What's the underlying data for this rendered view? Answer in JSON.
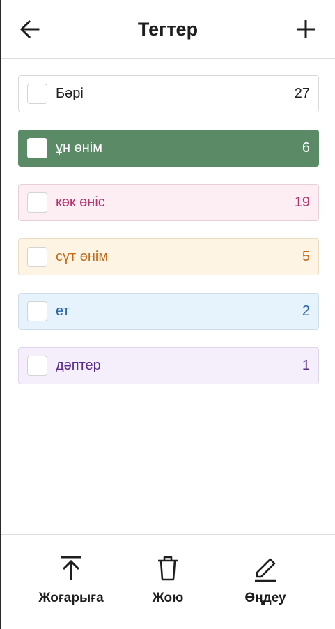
{
  "header": {
    "title": "Тегтер",
    "back_icon": "arrow-left-icon",
    "add_icon": "plus-icon"
  },
  "tags": [
    {
      "label": "Бәрі",
      "count": "27",
      "selected": false,
      "color": "#ffffff"
    },
    {
      "label": "ұн өнім",
      "count": "6",
      "selected": false,
      "color": "#5a8a66"
    },
    {
      "label": "көк өніс",
      "count": "19",
      "selected": false,
      "color": "#fdeef3"
    },
    {
      "label": "сүт өнім",
      "count": "5",
      "selected": false,
      "color": "#fdf4e3"
    },
    {
      "label": "ет",
      "count": "2",
      "selected": false,
      "color": "#e6f2fc"
    },
    {
      "label": "дәптер",
      "count": "1",
      "selected": false,
      "color": "#f5eefb"
    }
  ],
  "bottom_actions": {
    "move_top": {
      "label": "Жоғарыға",
      "icon": "arrow-up-to-line-icon"
    },
    "delete": {
      "label": "Жою",
      "icon": "trash-icon"
    },
    "edit": {
      "label": "Өңдеу",
      "icon": "pencil-icon"
    }
  }
}
